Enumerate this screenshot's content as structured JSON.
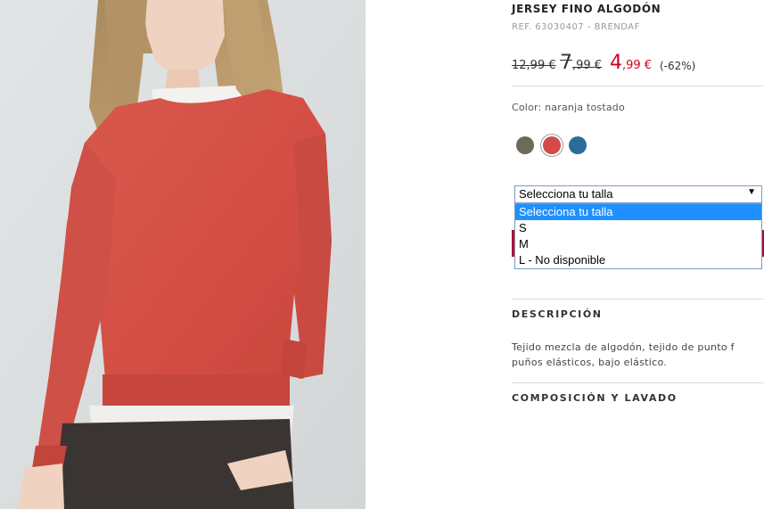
{
  "product": {
    "title": "JERSEY FINO ALGODÓN",
    "ref": "REF. 63030407 - BRENDAF"
  },
  "price": {
    "original": "12,99 €",
    "previous_int": "7",
    "previous_dec": ",99 €",
    "current_int": "4",
    "current_dec": ",99 €",
    "discount": "(-62%)",
    "current_color": "#d0021b"
  },
  "color": {
    "label": "Color: naranja tostado",
    "swatches": [
      {
        "name": "olive",
        "hex": "#6e6a59",
        "selected": false
      },
      {
        "name": "naranja tostado",
        "hex": "#d24a4a",
        "selected": true
      },
      {
        "name": "blue",
        "hex": "#2a6d9a",
        "selected": false
      }
    ]
  },
  "size": {
    "selected": "Selecciona tu talla",
    "options": [
      "Selecciona tu talla",
      "S",
      "M",
      "L - No disponible"
    ],
    "highlight_color": "#1e90ff"
  },
  "sections": {
    "description_heading": "DESCRIPCIÓN",
    "description_line1": "Tejido mezcla de algodón, tejido de punto f",
    "description_line2": "puños elásticos, bajo elástico.",
    "composition_heading": "COMPOSICIÓN Y LAVADO"
  },
  "photo": {
    "garment_color": "#d9544a"
  }
}
